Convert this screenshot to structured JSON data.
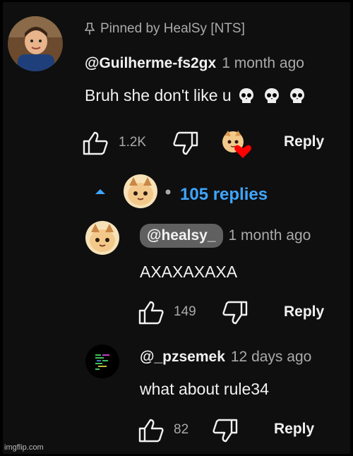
{
  "pinned": {
    "pin_text": "Pinned by HealSy [NTS]",
    "author": "@Guilherme-fs2gx",
    "time": "1 month ago",
    "text": "Bruh she don't like u",
    "like_count": "1.2K",
    "reply_label": "Reply"
  },
  "replies_toggle": {
    "label": "105 replies"
  },
  "replies": [
    {
      "author": "@healsy_",
      "time": "1 month ago",
      "text": "AXAXAXAXA",
      "like_count": "149",
      "reply_label": "Reply"
    },
    {
      "author": "@_pzsemek",
      "time": "12 days ago",
      "text": "what about rule34",
      "like_count": "82",
      "reply_label": "Reply"
    }
  ],
  "watermark": "imgflip.com",
  "colors": {
    "background": "#0f0f0f",
    "link": "#3ea6ff",
    "muted": "#aaaaaa",
    "heart": "#ff0000"
  }
}
